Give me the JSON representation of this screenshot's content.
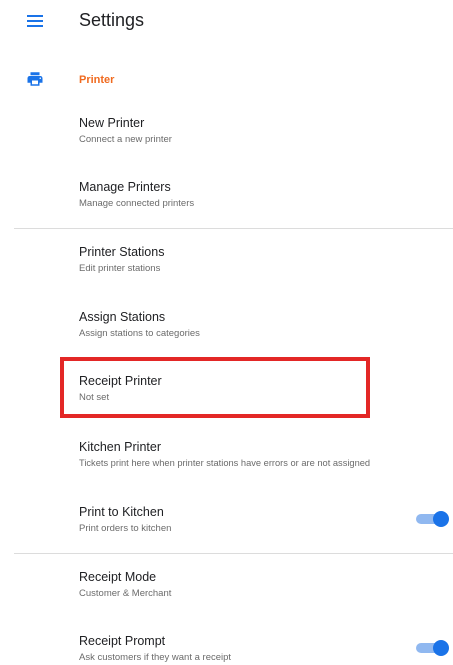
{
  "header": {
    "title": "Settings"
  },
  "section": {
    "label": "Printer"
  },
  "items": [
    {
      "title": "New Printer",
      "subtitle": "Connect a new printer"
    },
    {
      "title": "Manage Printers",
      "subtitle": "Manage connected printers"
    },
    {
      "title": "Printer Stations",
      "subtitle": "Edit printer stations"
    },
    {
      "title": "Assign Stations",
      "subtitle": "Assign stations to categories"
    },
    {
      "title": "Receipt Printer",
      "subtitle": "Not set"
    },
    {
      "title": "Kitchen Printer",
      "subtitle": "Tickets print here when printer stations have errors or are not assigned"
    },
    {
      "title": "Print to Kitchen",
      "subtitle": "Print orders to kitchen",
      "toggle_on": true
    },
    {
      "title": "Receipt Mode",
      "subtitle": "Customer & Merchant"
    },
    {
      "title": "Receipt Prompt",
      "subtitle": "Ask customers if they want a receipt",
      "toggle_on": true
    }
  ],
  "colors": {
    "accent": "#1a73e8",
    "section_label": "#f06a1f",
    "highlight": "#e32726"
  },
  "icons": {
    "menu": "menu-icon",
    "printer": "printer-icon"
  }
}
